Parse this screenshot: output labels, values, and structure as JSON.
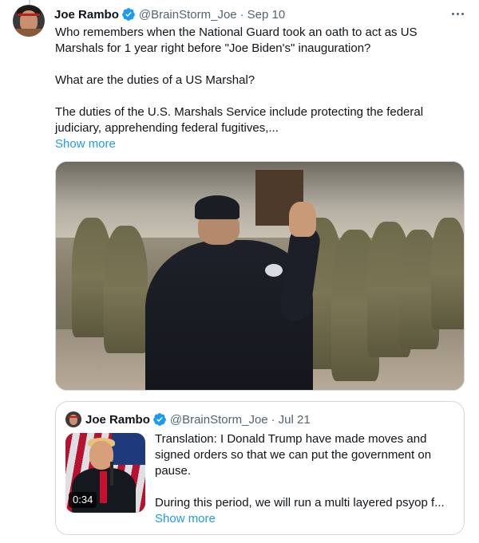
{
  "tweet": {
    "author": {
      "name": "Joe Rambo",
      "handle": "@BrainStorm_Joe",
      "date": "Sep 10",
      "verified": true
    },
    "text_paragraphs": [
      "Who remembers when the National Guard took an oath to act as US Marshals for 1 year right before \"Joe Biden's\" inauguration?",
      "What are the duties of a US Marshal?",
      "The duties of the U.S. Marshals Service include protecting the federal judiciary, apprehending federal fugitives,..."
    ],
    "show_more_label": "Show more",
    "separator": "·",
    "more_icon": "more-horizontal-icon"
  },
  "quote": {
    "author": {
      "name": "Joe Rambo",
      "handle": "@BrainStorm_Joe",
      "date": "Jul 21",
      "verified": true
    },
    "text_paragraphs": [
      "Translation:   I Donald Trump have made moves and signed orders so that we can put the government on pause.",
      "During this period, we will run a multi layered psyop f..."
    ],
    "video_duration": "0:34",
    "show_more_label": "Show more",
    "separator": "·"
  },
  "colors": {
    "accent": "#1d9bf0",
    "secondary_text": "#536471",
    "border": "#cfd9de",
    "verified_badge": "#1d9bf0"
  }
}
